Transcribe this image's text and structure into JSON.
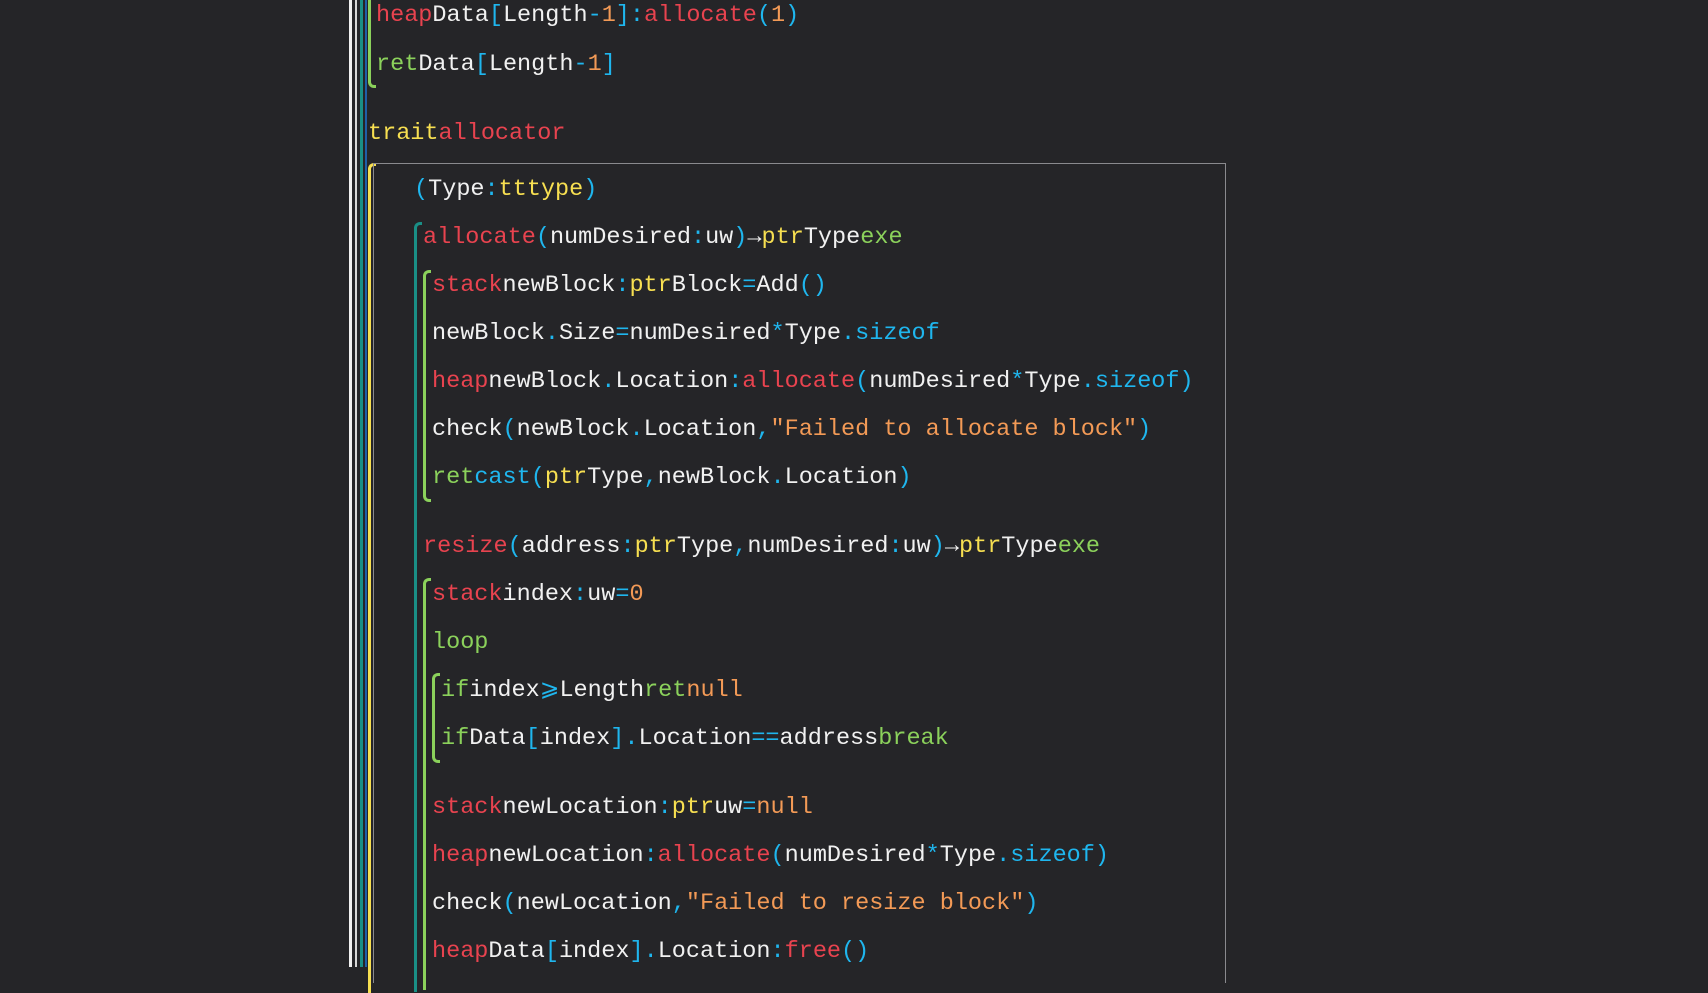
{
  "colors": {
    "background": "#252528",
    "keyword_red": "#e8434f",
    "identifier_white": "#f1f1f1",
    "punct_cyan": "#1fb6ee",
    "number_orange": "#f39a56",
    "type_yellow": "#f7df51",
    "flow_green": "#8bd15b",
    "guide_teal": "#1a8f86"
  },
  "lines": [
    {
      "tokens": [
        {
          "t": "heap",
          "k": "r"
        },
        {
          "t": "Data",
          "k": "w"
        },
        {
          "t": "[",
          "k": "c"
        },
        {
          "t": "Length",
          "k": "w"
        },
        {
          "t": "-",
          "k": "c"
        },
        {
          "t": "1",
          "k": "o"
        },
        {
          "t": "]",
          "k": "c"
        },
        {
          "t": ":",
          "k": "c"
        },
        {
          "t": "allocate",
          "k": "r"
        },
        {
          "t": "(",
          "k": "c"
        },
        {
          "t": "1",
          "k": "o"
        },
        {
          "t": ")",
          "k": "c"
        }
      ]
    },
    {
      "tokens": [
        {
          "t": "ret",
          "k": "g"
        },
        {
          "t": "Data",
          "k": "w"
        },
        {
          "t": "[",
          "k": "c"
        },
        {
          "t": "Length",
          "k": "w"
        },
        {
          "t": "-",
          "k": "c"
        },
        {
          "t": "1",
          "k": "o"
        },
        {
          "t": "]",
          "k": "c"
        }
      ]
    },
    {
      "tokens": [
        {
          "t": "trait",
          "k": "y"
        },
        {
          "t": "allocator",
          "k": "r"
        }
      ]
    },
    {
      "tokens": [
        {
          "t": "(",
          "k": "c"
        },
        {
          "t": "Type",
          "k": "w"
        },
        {
          "t": ":",
          "k": "c"
        },
        {
          "t": "tttype",
          "k": "y"
        },
        {
          "t": ")",
          "k": "c"
        }
      ]
    },
    {
      "tokens": [
        {
          "t": "allocate",
          "k": "r"
        },
        {
          "t": "(",
          "k": "c"
        },
        {
          "t": "numDesired",
          "k": "w"
        },
        {
          "t": ":",
          "k": "c"
        },
        {
          "t": "uw",
          "k": "w"
        },
        {
          "t": ")",
          "k": "c"
        },
        {
          "t": "→",
          "k": "w"
        },
        {
          "t": "ptr",
          "k": "y"
        },
        {
          "t": "Type",
          "k": "w"
        },
        {
          "t": "exe",
          "k": "g"
        }
      ]
    },
    {
      "tokens": [
        {
          "t": "stack",
          "k": "r"
        },
        {
          "t": "newBlock",
          "k": "w"
        },
        {
          "t": ":",
          "k": "c"
        },
        {
          "t": "ptr",
          "k": "y"
        },
        {
          "t": "Block",
          "k": "w"
        },
        {
          "t": "=",
          "k": "c"
        },
        {
          "t": "Add",
          "k": "w"
        },
        {
          "t": "()",
          "k": "c"
        }
      ]
    },
    {
      "tokens": [
        {
          "t": "newBlock",
          "k": "w"
        },
        {
          "t": ".",
          "k": "c"
        },
        {
          "t": "Size",
          "k": "w"
        },
        {
          "t": "=",
          "k": "c"
        },
        {
          "t": "numDesired",
          "k": "w"
        },
        {
          "t": "*",
          "k": "c"
        },
        {
          "t": "Type",
          "k": "w"
        },
        {
          "t": ".sizeof",
          "k": "c"
        }
      ]
    },
    {
      "tokens": [
        {
          "t": "heap",
          "k": "r"
        },
        {
          "t": "newBlock",
          "k": "w"
        },
        {
          "t": ".",
          "k": "c"
        },
        {
          "t": "Location",
          "k": "w"
        },
        {
          "t": ":",
          "k": "c"
        },
        {
          "t": "allocate",
          "k": "r"
        },
        {
          "t": "(",
          "k": "c"
        },
        {
          "t": "numDesired",
          "k": "w"
        },
        {
          "t": "*",
          "k": "c"
        },
        {
          "t": "Type",
          "k": "w"
        },
        {
          "t": ".sizeof)",
          "k": "c"
        }
      ]
    },
    {
      "tokens": [
        {
          "t": "check",
          "k": "w"
        },
        {
          "t": "(",
          "k": "c"
        },
        {
          "t": "newBlock",
          "k": "w"
        },
        {
          "t": ".",
          "k": "c"
        },
        {
          "t": "Location",
          "k": "w"
        },
        {
          "t": ",",
          "k": "c"
        },
        {
          "t": "\"Failed to allocate block\"",
          "k": "s"
        },
        {
          "t": ")",
          "k": "c"
        }
      ]
    },
    {
      "tokens": [
        {
          "t": "ret",
          "k": "g"
        },
        {
          "t": "cast",
          "k": "c"
        },
        {
          "t": "(",
          "k": "c"
        },
        {
          "t": "ptr",
          "k": "y"
        },
        {
          "t": "Type",
          "k": "w"
        },
        {
          "t": ",",
          "k": "c"
        },
        {
          "t": "newBlock",
          "k": "w"
        },
        {
          "t": ".",
          "k": "c"
        },
        {
          "t": "Location",
          "k": "w"
        },
        {
          "t": ")",
          "k": "c"
        }
      ]
    },
    {
      "tokens": [
        {
          "t": "resize",
          "k": "r"
        },
        {
          "t": "(",
          "k": "c"
        },
        {
          "t": "address",
          "k": "w"
        },
        {
          "t": ":",
          "k": "c"
        },
        {
          "t": "ptr",
          "k": "y"
        },
        {
          "t": "Type",
          "k": "w"
        },
        {
          "t": ",",
          "k": "c"
        },
        {
          "t": "numDesired",
          "k": "w"
        },
        {
          "t": ":",
          "k": "c"
        },
        {
          "t": "uw",
          "k": "w"
        },
        {
          "t": ")",
          "k": "c"
        },
        {
          "t": "→",
          "k": "w"
        },
        {
          "t": "ptr",
          "k": "y"
        },
        {
          "t": "Type",
          "k": "w"
        },
        {
          "t": "exe",
          "k": "g"
        }
      ]
    },
    {
      "tokens": [
        {
          "t": "stack",
          "k": "r"
        },
        {
          "t": "index",
          "k": "w"
        },
        {
          "t": ":",
          "k": "c"
        },
        {
          "t": "uw",
          "k": "w"
        },
        {
          "t": "=",
          "k": "c"
        },
        {
          "t": "0",
          "k": "o"
        }
      ]
    },
    {
      "tokens": [
        {
          "t": "loop",
          "k": "g"
        }
      ]
    },
    {
      "tokens": [
        {
          "t": "if",
          "k": "g"
        },
        {
          "t": "index",
          "k": "w"
        },
        {
          "t": "⩾",
          "k": "c"
        },
        {
          "t": "Length",
          "k": "w"
        },
        {
          "t": "ret",
          "k": "g"
        },
        {
          "t": "null",
          "k": "o"
        }
      ]
    },
    {
      "tokens": [
        {
          "t": "if",
          "k": "g"
        },
        {
          "t": "Data",
          "k": "w"
        },
        {
          "t": "[",
          "k": "c"
        },
        {
          "t": "index",
          "k": "w"
        },
        {
          "t": "]",
          "k": "c"
        },
        {
          "t": ".",
          "k": "c"
        },
        {
          "t": "Location",
          "k": "w"
        },
        {
          "t": "==",
          "k": "c"
        },
        {
          "t": "address",
          "k": "w"
        },
        {
          "t": "break",
          "k": "g"
        }
      ]
    },
    {
      "tokens": [
        {
          "t": "stack",
          "k": "r"
        },
        {
          "t": "newLocation",
          "k": "w"
        },
        {
          "t": ":",
          "k": "c"
        },
        {
          "t": "ptr",
          "k": "y"
        },
        {
          "t": "uw",
          "k": "w"
        },
        {
          "t": "=",
          "k": "c"
        },
        {
          "t": "null",
          "k": "o"
        }
      ]
    },
    {
      "tokens": [
        {
          "t": "heap",
          "k": "r"
        },
        {
          "t": "newLocation",
          "k": "w"
        },
        {
          "t": ":",
          "k": "c"
        },
        {
          "t": "allocate",
          "k": "r"
        },
        {
          "t": "(",
          "k": "c"
        },
        {
          "t": "numDesired",
          "k": "w"
        },
        {
          "t": "*",
          "k": "c"
        },
        {
          "t": "Type",
          "k": "w"
        },
        {
          "t": ".sizeof)",
          "k": "c"
        }
      ]
    },
    {
      "tokens": [
        {
          "t": "check",
          "k": "w"
        },
        {
          "t": "(",
          "k": "c"
        },
        {
          "t": "newLocation",
          "k": "w"
        },
        {
          "t": ",",
          "k": "c"
        },
        {
          "t": "\"Failed to resize block\"",
          "k": "s"
        },
        {
          "t": ")",
          "k": "c"
        }
      ]
    },
    {
      "tokens": [
        {
          "t": "heap",
          "k": "r"
        },
        {
          "t": "Data",
          "k": "w"
        },
        {
          "t": "[",
          "k": "c"
        },
        {
          "t": "index",
          "k": "w"
        },
        {
          "t": "]",
          "k": "c"
        },
        {
          "t": ".",
          "k": "c"
        },
        {
          "t": "Location",
          "k": "w"
        },
        {
          "t": ":",
          "k": "c"
        },
        {
          "t": "free",
          "k": "r"
        },
        {
          "t": "()",
          "k": "c"
        }
      ]
    }
  ]
}
